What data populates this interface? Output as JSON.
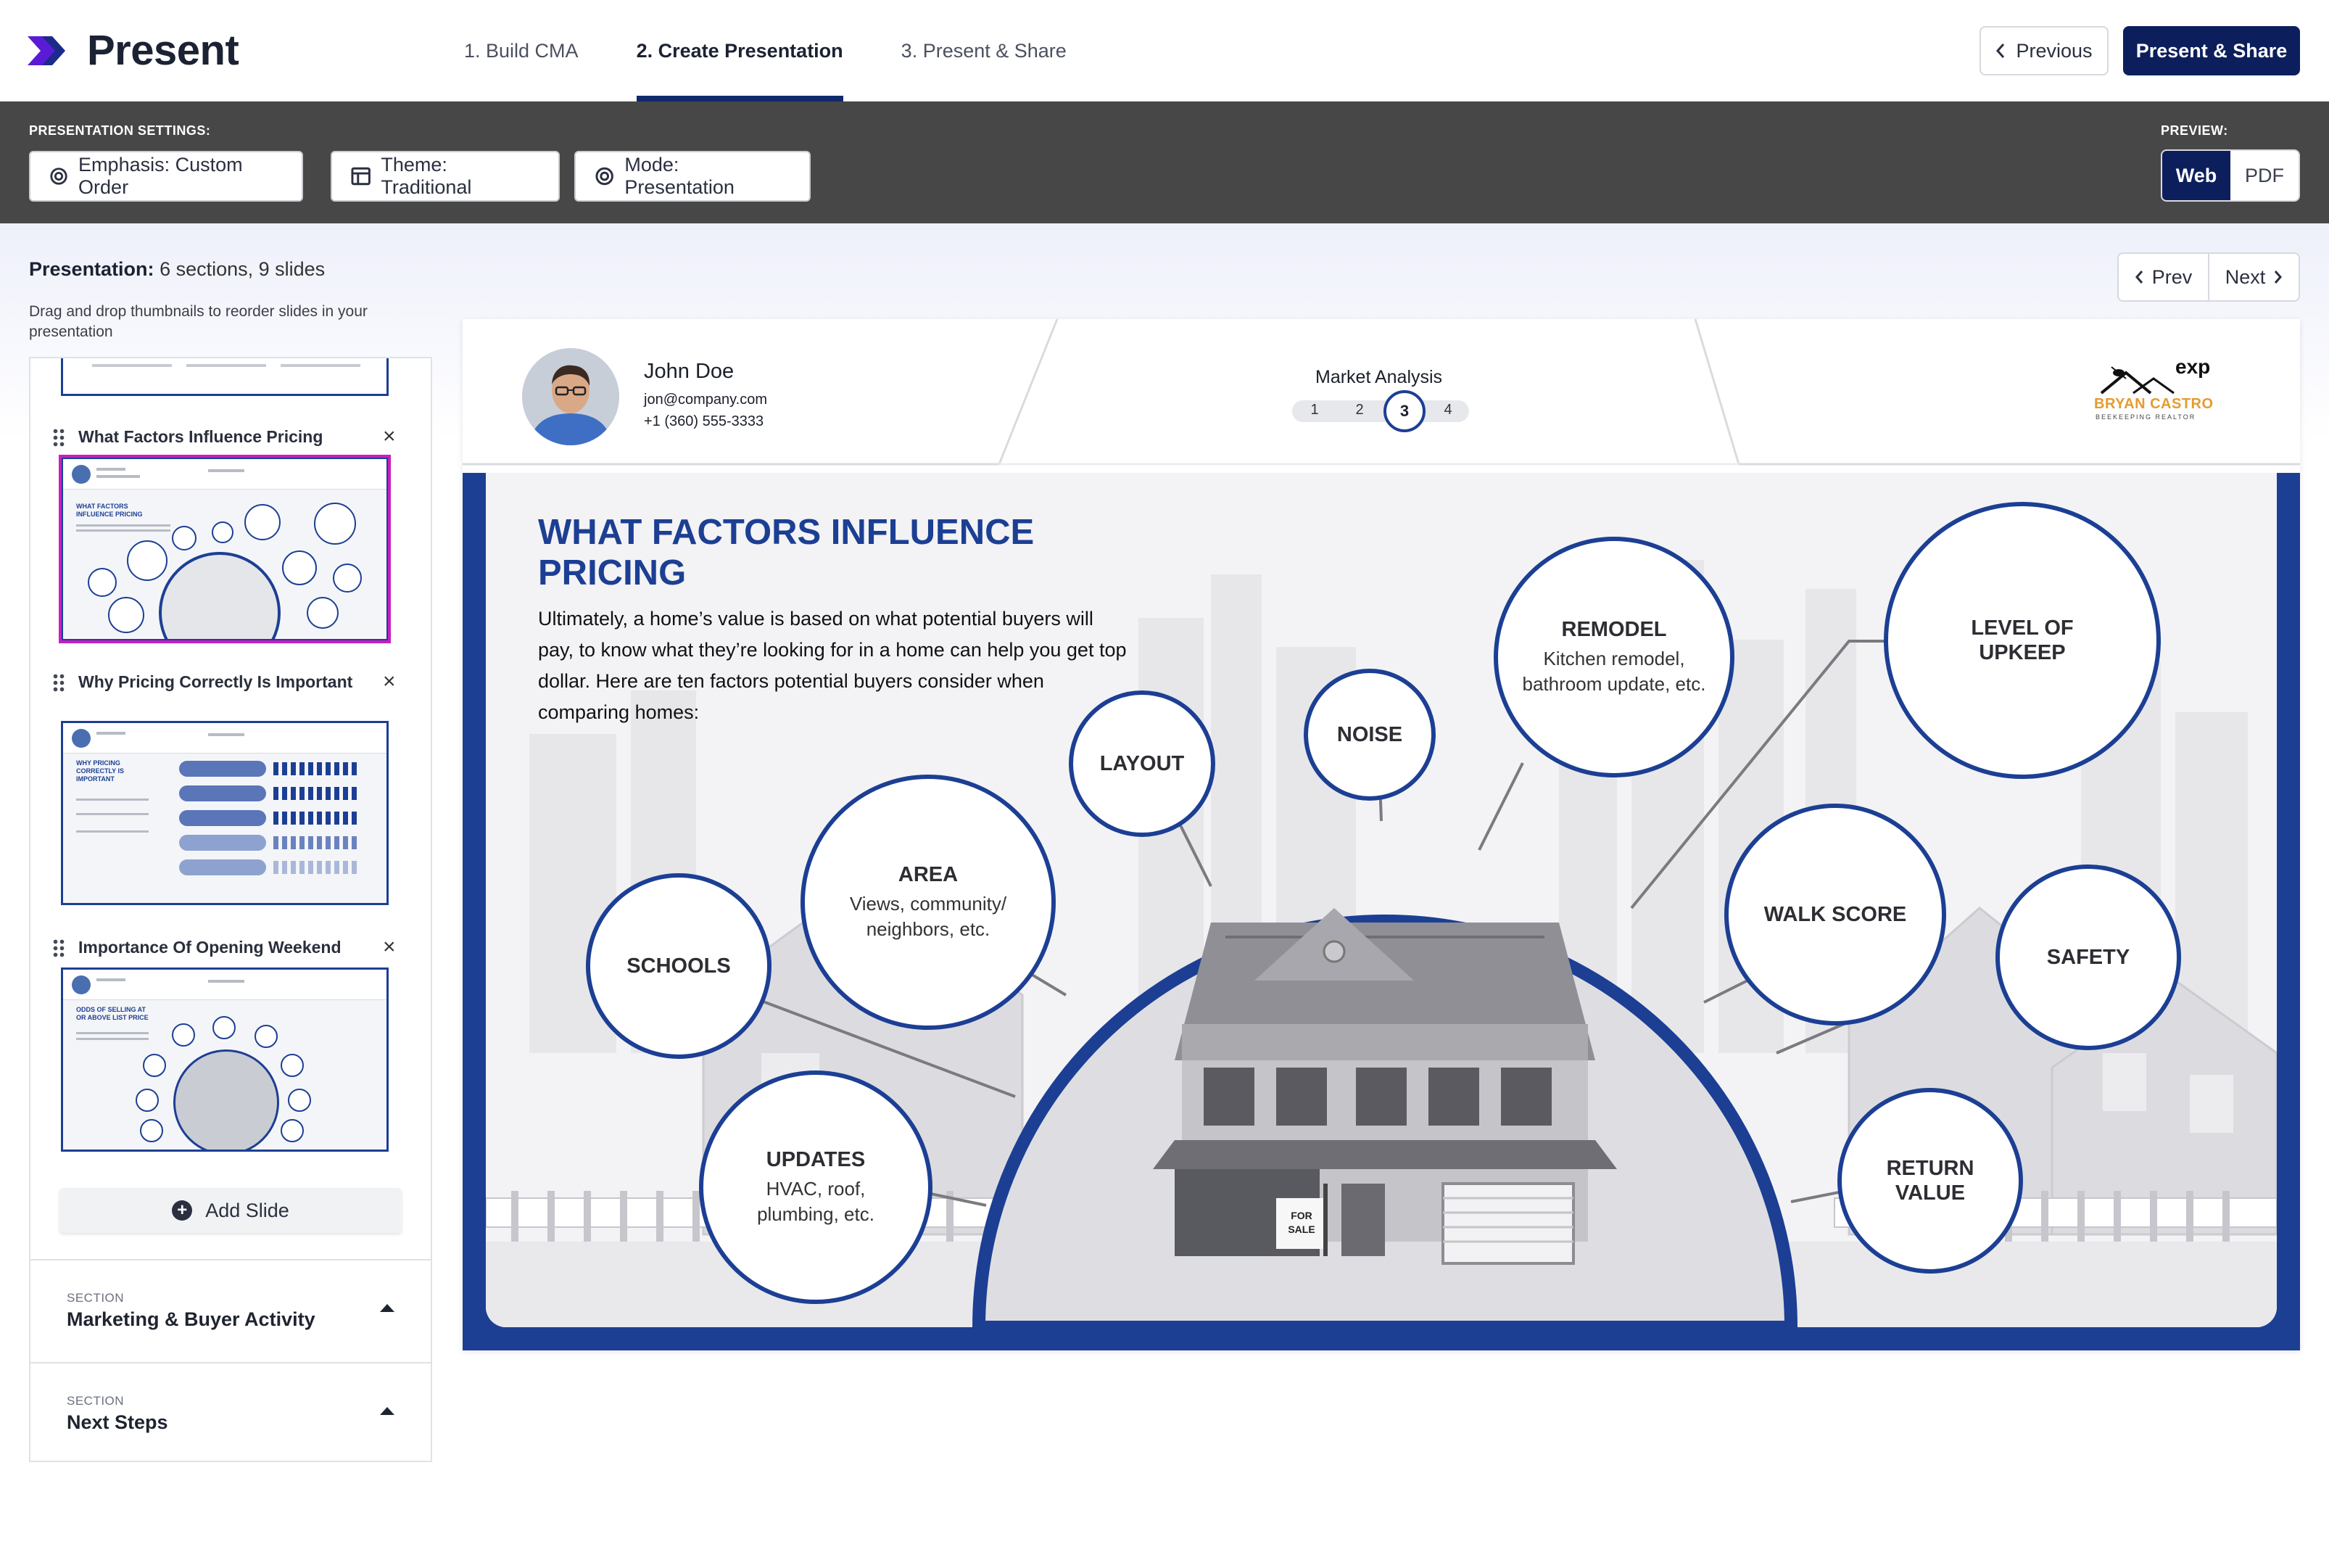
{
  "app": {
    "title": "Present"
  },
  "nav": {
    "steps": [
      {
        "label": "1. Build CMA"
      },
      {
        "label": "2. Create Presentation"
      },
      {
        "label": "3. Present & Share"
      }
    ],
    "previous_label": "Previous",
    "present_share_label": "Present & Share"
  },
  "settings": {
    "label": "PRESENTATION SETTINGS:",
    "emphasis": "Emphasis: Custom Order",
    "theme": "Theme: Traditional",
    "mode": "Mode: Presentation",
    "preview_label": "PREVIEW:",
    "preview_options": [
      "Web",
      "PDF"
    ],
    "preview_selected": "Web"
  },
  "sidebar": {
    "presentation_label": "Presentation:",
    "presentation_summary": "6 sections, 9 slides",
    "drag_hint": "Drag and drop thumbnails to reorder slides in your presentation",
    "slides": [
      {
        "title": "What Factors Influence Pricing",
        "selected": true,
        "thumb_title": "WHAT FACTORS INFLUENCE PRICING"
      },
      {
        "title": "Why Pricing Correctly Is Important",
        "selected": false,
        "thumb_title": "WHY PRICING CORRECTLY IS IMPORTANT"
      },
      {
        "title": "Importance Of Opening Weekend",
        "selected": false,
        "thumb_title": "ODDS OF SELLING AT OR ABOVE LIST PRICE"
      }
    ],
    "add_slide_label": "Add Slide",
    "sections": [
      {
        "eyebrow": "SECTION",
        "name": "Marketing & Buyer Activity"
      },
      {
        "eyebrow": "SECTION",
        "name": "Next Steps"
      }
    ]
  },
  "preview_nav": {
    "prev_label": "Prev",
    "next_label": "Next"
  },
  "slide": {
    "agent": {
      "name": "John Doe",
      "email": "jon@company.com",
      "phone": "+1 (360) 555-3333"
    },
    "section_label": "Market Analysis",
    "pager": [
      "1",
      "2",
      "3",
      "4"
    ],
    "pager_current": "3",
    "logo": {
      "brand": "exp",
      "name": "BRYAN CASTRO",
      "tagline": "BEEKEEPING REALTOR"
    },
    "title": "What Factors Influence Pricing",
    "description": "Ultimately, a home’s value is based on what potential buyers will pay, to know what they’re looking for in a home can help you get top dollar. Here are ten factors potential buyers consider when comparing homes:",
    "factors": {
      "layout": {
        "title": "LAYOUT"
      },
      "noise": {
        "title": "NOISE"
      },
      "remodel": {
        "title": "REMODEL",
        "sub": "Kitchen remodel, bathroom update, etc."
      },
      "upkeep": {
        "title": "LEVEL OF UPKEEP"
      },
      "area": {
        "title": "AREA",
        "sub": "Views, community/ neighbors, etc."
      },
      "schools": {
        "title": "SCHOOLS"
      },
      "walk": {
        "title": "WALK SCORE"
      },
      "safety": {
        "title": "SAFETY"
      },
      "updates": {
        "title": "UPDATES",
        "sub": "HVAC, roof, plumbing, etc."
      },
      "return": {
        "title": "RETURN VALUE"
      }
    },
    "sale_sign": "FOR SALE"
  },
  "colors": {
    "primary_navy": "#0c1f5c",
    "slide_blue": "#1c3f94",
    "settings_bar": "#474747",
    "logo_orange": "#e59b2f",
    "selected_thumb": "#c71fc0"
  }
}
